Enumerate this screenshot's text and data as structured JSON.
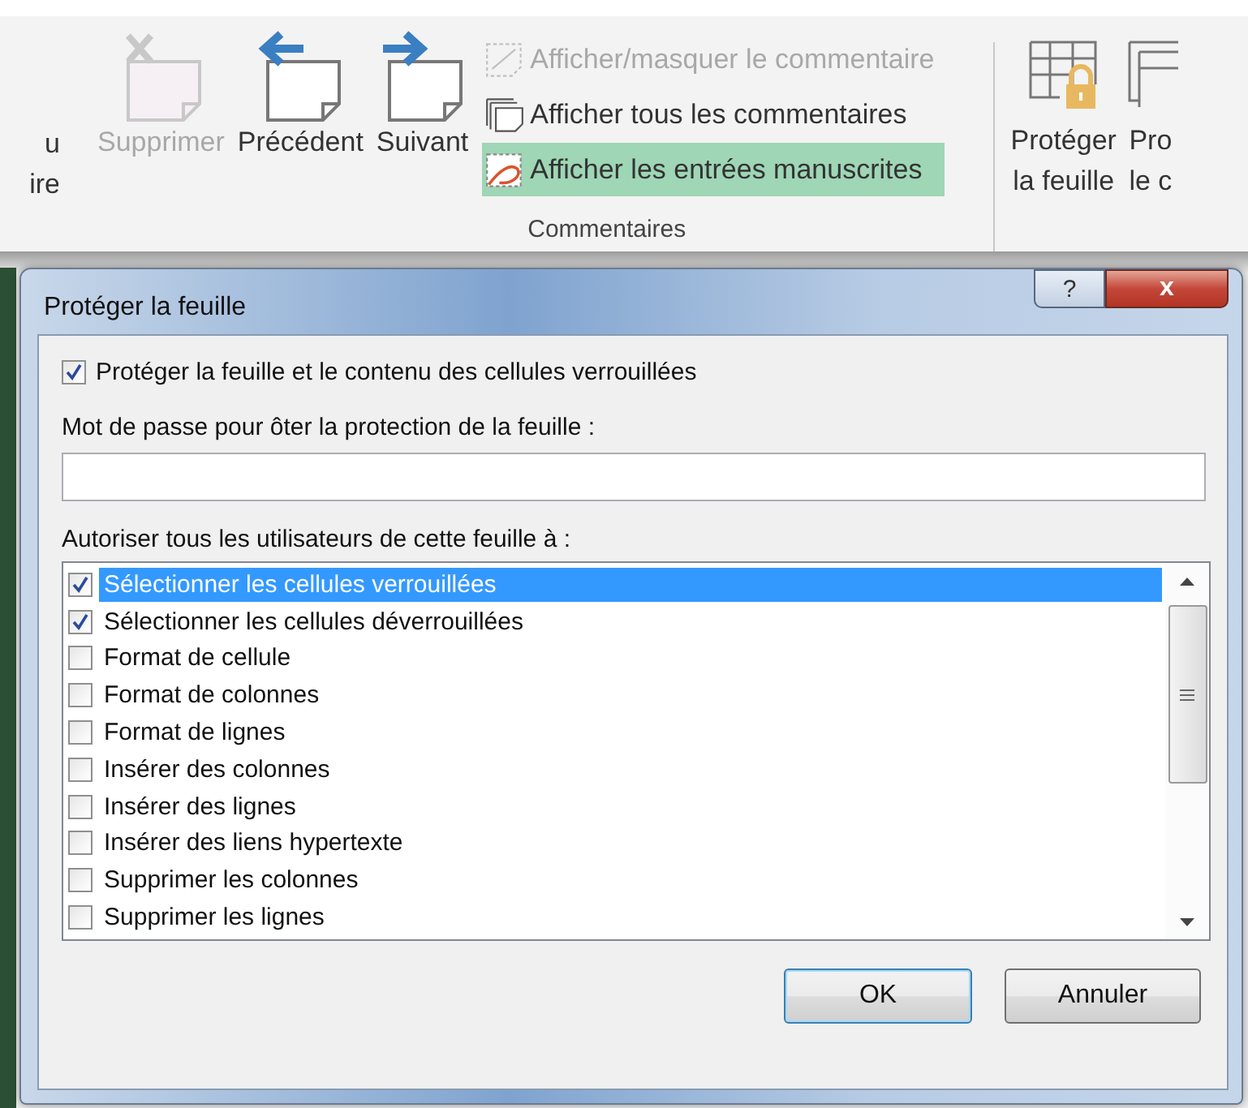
{
  "ribbon": {
    "cut_button": {
      "lines": [
        "u",
        "ire"
      ]
    },
    "buttons": [
      {
        "label": "Supprimer",
        "kind": "delete",
        "disabled": true
      },
      {
        "label": "Précédent",
        "kind": "previous",
        "disabled": false
      },
      {
        "label": "Suivant",
        "kind": "next",
        "disabled": false
      }
    ],
    "small_buttons": [
      {
        "label": "Afficher/masquer le commentaire",
        "kind": "show-hide",
        "disabled": true,
        "selected": false
      },
      {
        "label": "Afficher tous les commentaires",
        "kind": "show-all",
        "disabled": false,
        "selected": false
      },
      {
        "label": "Afficher les entrées manuscrites",
        "kind": "ink",
        "disabled": false,
        "selected": true
      }
    ],
    "group_label": "Commentaires",
    "right_buttons": [
      {
        "lines": [
          "Protéger",
          "la feuille"
        ],
        "kind": "protect-sheet"
      },
      {
        "lines": [
          "Pro",
          "le c"
        ],
        "kind": "protect-workbook"
      }
    ]
  },
  "dialog": {
    "title": "Protéger la feuille",
    "help": "?",
    "close": "x",
    "protect_checkbox": {
      "label": "Protéger la feuille et le contenu des cellules verrouillées",
      "checked": true
    },
    "password_label": "Mot de passe pour ôter la protection de la feuille :",
    "list_label": "Autoriser tous les utilisateurs de cette feuille à :",
    "items": [
      {
        "label": "Sélectionner les cellules verrouillées",
        "checked": true,
        "selected": true
      },
      {
        "label": "Sélectionner les cellules déverrouillées",
        "checked": true,
        "selected": false
      },
      {
        "label": "Format de cellule",
        "checked": false,
        "selected": false
      },
      {
        "label": "Format de colonnes",
        "checked": false,
        "selected": false
      },
      {
        "label": "Format de lignes",
        "checked": false,
        "selected": false
      },
      {
        "label": "Insérer des colonnes",
        "checked": false,
        "selected": false
      },
      {
        "label": "Insérer des lignes",
        "checked": false,
        "selected": false
      },
      {
        "label": "Insérer des liens hypertexte",
        "checked": false,
        "selected": false
      },
      {
        "label": "Supprimer les colonnes",
        "checked": false,
        "selected": false
      },
      {
        "label": "Supprimer les lignes",
        "checked": false,
        "selected": false
      }
    ],
    "ok": "OK",
    "cancel": "Annuler"
  }
}
